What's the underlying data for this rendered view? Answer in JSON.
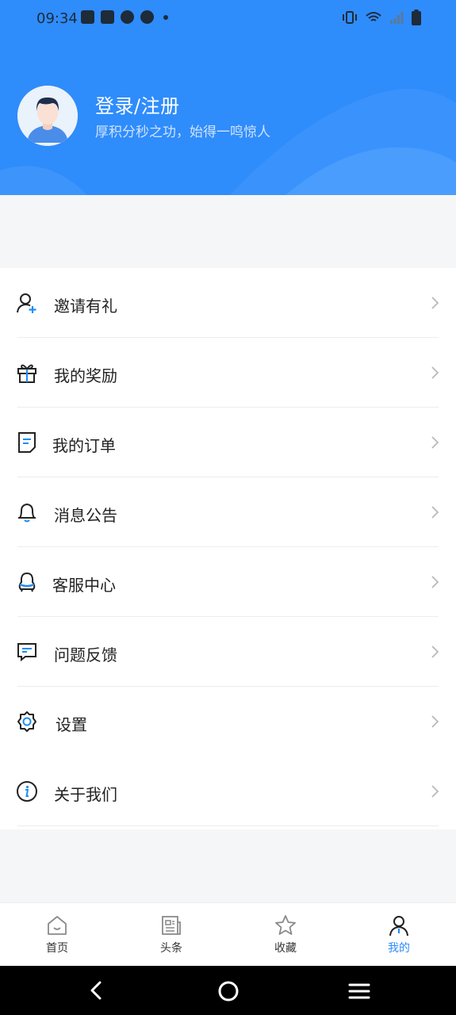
{
  "status_bar": {
    "time": "09:34"
  },
  "profile": {
    "title": "登录/注册",
    "subtitle": "厚积分秒之功，始得一鸣惊人",
    "avatar_icon": "user-avatar"
  },
  "menu": {
    "items": [
      {
        "label": "邀请有礼",
        "icon": "add-user-icon"
      },
      {
        "label": "我的奖励",
        "icon": "gift-icon"
      },
      {
        "label": "我的订单",
        "icon": "order-icon"
      },
      {
        "label": "消息公告",
        "icon": "bell-icon"
      },
      {
        "label": "客服中心",
        "icon": "customer-service-icon"
      },
      {
        "label": "问题反馈",
        "icon": "feedback-icon"
      },
      {
        "label": "设置",
        "icon": "gear-icon"
      },
      {
        "label": "关于我们",
        "icon": "info-icon"
      }
    ]
  },
  "tabbar": {
    "tabs": [
      {
        "label": "首页",
        "icon": "home-icon"
      },
      {
        "label": "头条",
        "icon": "news-icon"
      },
      {
        "label": "收藏",
        "icon": "star-icon"
      },
      {
        "label": "我的",
        "icon": "profile-icon"
      }
    ],
    "active_index": 3
  },
  "colors": {
    "accent": "#2f8cfb",
    "icon_accent": "#1f8ef1",
    "text": "#222222"
  }
}
